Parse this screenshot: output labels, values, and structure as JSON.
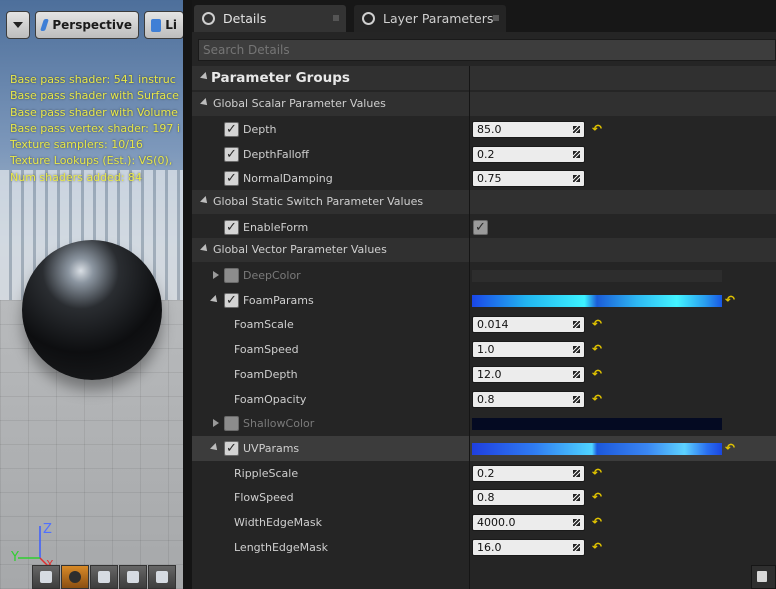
{
  "viewport": {
    "perspective_label": "Perspective",
    "lit_label": "Li",
    "stats": [
      "Base pass shader: 541 instruc",
      "Base pass shader with Surface",
      "Base pass shader with Volume",
      "Base pass vertex shader: 197 i",
      "Texture samplers: 10/16",
      "Texture Lookups (Est.): VS(0),",
      "Num shaders added: 84"
    ],
    "gizmo": {
      "z_label": "Z",
      "y_label": "Y",
      "x_label": "X"
    }
  },
  "tabs": [
    {
      "label": "Details",
      "active": true
    },
    {
      "label": "Layer Parameters",
      "active": false
    }
  ],
  "search": {
    "placeholder": "Search Details"
  },
  "details": {
    "header": "Parameter Groups",
    "scalar_group": "Global Scalar Parameter Values",
    "switch_group": "Global Static Switch Parameter Values",
    "vector_group": "Global Vector Parameter Values",
    "params": {
      "depth": {
        "label": "Depth",
        "value": "85.0",
        "checked": true
      },
      "depth_falloff": {
        "label": "DepthFalloff",
        "value": "0.2",
        "checked": true
      },
      "normal_damping": {
        "label": "NormalDamping",
        "value": "0.75",
        "checked": true
      },
      "enable_form": {
        "label": "EnableForm",
        "checked": true,
        "value_checked": true
      },
      "deep_color": {
        "label": "DeepColor",
        "checked": false,
        "color": "#2d2d2d"
      },
      "foam_params": {
        "label": "FoamParams",
        "checked": true
      },
      "foam_scale": {
        "label": "FoamScale",
        "value": "0.014"
      },
      "foam_speed": {
        "label": "FoamSpeed",
        "value": "1.0"
      },
      "foam_depth": {
        "label": "FoamDepth",
        "value": "12.0"
      },
      "foam_opacity": {
        "label": "FoamOpacity",
        "value": "0.8"
      },
      "shallow_color": {
        "label": "ShallowColor",
        "checked": false,
        "color": "#040a22"
      },
      "uv_params": {
        "label": "UVParams",
        "checked": true
      },
      "ripple_scale": {
        "label": "RippleScale",
        "value": "0.2"
      },
      "flow_speed": {
        "label": "FlowSpeed",
        "value": "0.8"
      },
      "width_edge_mask": {
        "label": "WidthEdgeMask",
        "value": "4000.0"
      },
      "length_edge_mask": {
        "label": "LengthEdgeMask",
        "value": "16.0"
      }
    },
    "check_glyph": "✓",
    "reset_glyph": "↶"
  },
  "colors": {
    "accent_yellow": "#e2c400",
    "panel_bg": "#252525",
    "stats_text": "#e8e84a"
  }
}
